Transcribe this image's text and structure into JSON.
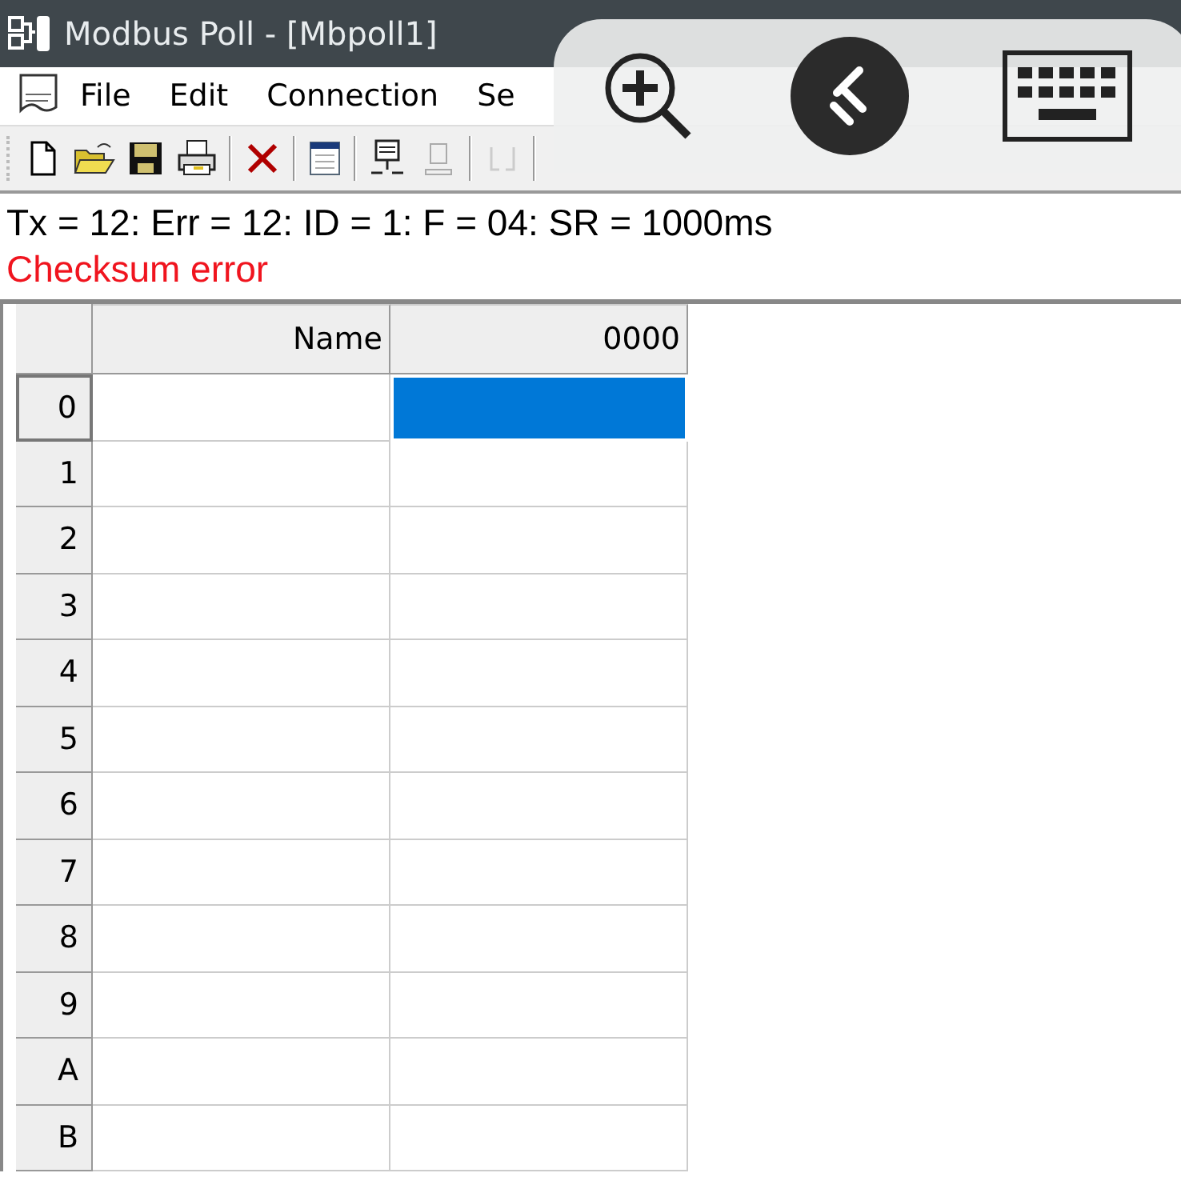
{
  "window": {
    "title": "Modbus Poll - [Mbpoll1]"
  },
  "menu": [
    {
      "label": "File"
    },
    {
      "label": "Edit"
    },
    {
      "label": "Connection"
    },
    {
      "label": "Se"
    }
  ],
  "status": {
    "line": "Tx = 12: Err = 12: ID = 1: F = 04: SR = 1000ms",
    "error": "Checksum error"
  },
  "table": {
    "columns": [
      "Name",
      "0000"
    ],
    "rows": [
      {
        "label": "0",
        "selected": true
      },
      {
        "label": "1",
        "selected": false
      },
      {
        "label": "2",
        "selected": false
      },
      {
        "label": "3",
        "selected": false
      },
      {
        "label": "4",
        "selected": false
      },
      {
        "label": "5",
        "selected": false
      },
      {
        "label": "6",
        "selected": false
      },
      {
        "label": "7",
        "selected": false
      },
      {
        "label": "8",
        "selected": false
      },
      {
        "label": "9",
        "selected": false
      },
      {
        "label": "A",
        "selected": false
      },
      {
        "label": "B",
        "selected": false
      }
    ]
  }
}
